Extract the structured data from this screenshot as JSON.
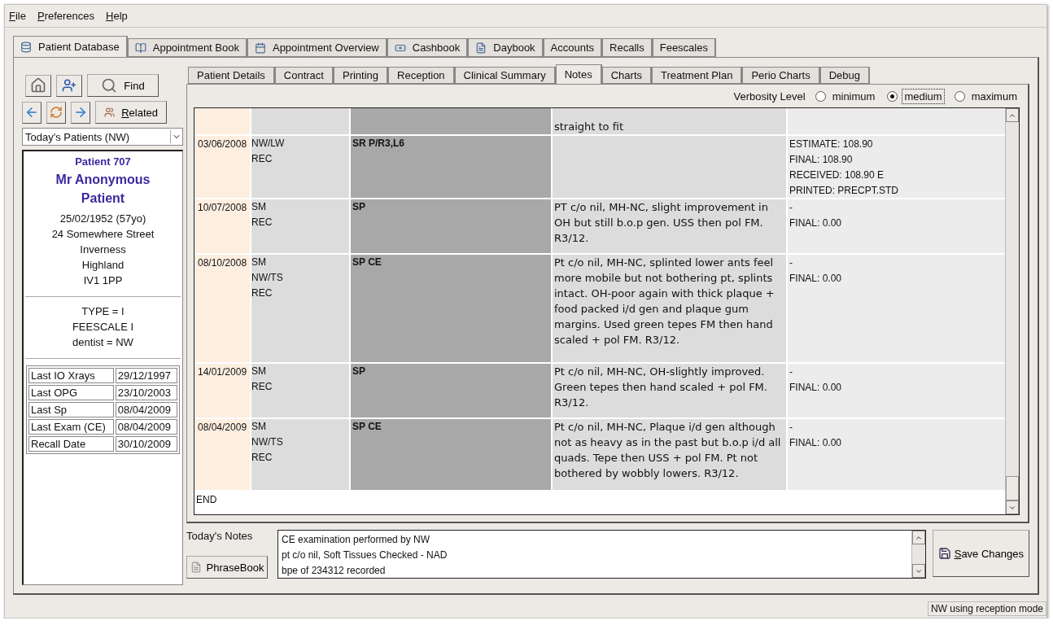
{
  "menu": [
    "File",
    "Preferences",
    "Help"
  ],
  "tabs": [
    {
      "label": "Patient Database",
      "selected": true
    },
    {
      "label": "Appointment Book",
      "selected": false
    },
    {
      "label": "Appointment Overview",
      "selected": false
    },
    {
      "label": "Cashbook",
      "selected": false
    },
    {
      "label": "Daybook",
      "selected": false
    },
    {
      "label": "Accounts",
      "selected": false
    },
    {
      "label": "Recalls",
      "selected": false
    },
    {
      "label": "Feescales",
      "selected": false
    }
  ],
  "sidebar": {
    "find_button": "Find",
    "related_button": "Related",
    "patient_list": "Today's Patients (NW)",
    "patient": {
      "heading": "Patient 707",
      "name": "Mr Anonymous Patient",
      "address": [
        "25/02/1952 (57yo)",
        "24 Somewhere Street",
        "Inverness",
        "Highland",
        "IV1 1PP"
      ],
      "details": [
        "TYPE = I",
        "FEESCALE I",
        "dentist = NW"
      ]
    },
    "history": [
      {
        "label": "Last IO Xrays",
        "date": "29/12/1997"
      },
      {
        "label": "Last OPG",
        "date": "23/10/2003"
      },
      {
        "label": "Last Sp",
        "date": "08/04/2009"
      },
      {
        "label": "Last Exam (CE)",
        "date": "08/04/2009"
      },
      {
        "label": "Recall Date",
        "date": "30/10/2009"
      }
    ]
  },
  "subtabs": [
    {
      "label": "Patient Details",
      "selected": false
    },
    {
      "label": "Contract",
      "selected": false
    },
    {
      "label": "Printing",
      "selected": false
    },
    {
      "label": "Reception",
      "selected": false
    },
    {
      "label": "Clinical Summary",
      "selected": false
    },
    {
      "label": "Notes",
      "selected": true
    },
    {
      "label": "Charts",
      "selected": false
    },
    {
      "label": "Treatment Plan",
      "selected": false
    },
    {
      "label": "Perio Charts",
      "selected": false
    },
    {
      "label": "Debug",
      "selected": false
    }
  ],
  "verbosity": {
    "label": "Verbosity Level",
    "options": [
      {
        "label": "minimum",
        "selected": false
      },
      {
        "label": "medium",
        "selected": true
      },
      {
        "label": "maximum",
        "selected": false
      }
    ]
  },
  "notes_table": {
    "rows": [
      {
        "date": "",
        "clinicians": [],
        "treatment": "",
        "notes": "straight to fit",
        "fees": []
      },
      {
        "date": "03/06/2008",
        "clinicians": [
          "NW/LW",
          "REC"
        ],
        "treatment": "SR P/R3,L6",
        "notes": "",
        "fees": [
          "ESTIMATE: 108.90",
          "FINAL: 108.90",
          "RECEIVED: 108.90 E",
          "PRINTED: PRECPT.STD"
        ]
      },
      {
        "date": "10/07/2008",
        "clinicians": [
          "SM",
          "REC"
        ],
        "treatment": "SP",
        "notes": "PT c/o nil, MH-NC, slight improvement in OH but still b.o.p gen. USS then pol FM. R3/12.",
        "fees": [
          "-",
          "FINAL: 0.00"
        ]
      },
      {
        "date": "08/10/2008",
        "clinicians": [
          "SM",
          "NW/TS",
          "REC"
        ],
        "treatment": "SP CE",
        "notes": "Pt c/o nil, MH-NC, splinted lower ants feel more mobile but not bothering pt, splints intact. OH-poor again with thick plaque + food packed i/d gen and plaque gum margins. Used green tepes FM then hand scaled + pol FM. R3/12.",
        "fees": [
          "-",
          "FINAL: 0.00"
        ]
      },
      {
        "date": "14/01/2009",
        "clinicians": [
          "SM",
          "REC"
        ],
        "treatment": "SP",
        "notes": "Pt c/o nil, MH-NC, OH-slightly improved. Green tepes then hand scaled + pol FM. R3/12.",
        "fees": [
          "-",
          "FINAL: 0.00"
        ]
      },
      {
        "date": "08/04/2009",
        "clinicians": [
          "SM",
          "NW/TS",
          "REC"
        ],
        "treatment": "SP CE",
        "notes": "Pt c/o nil, MH-NC, Plaque i/d gen although not as heavy as in the past but b.o.p i/d all quads. Tepe then USS + pol FM. Pt not bothered by wobbly lowers. R3/12.",
        "fees": [
          "-",
          "FINAL: 0.00"
        ]
      }
    ],
    "end": "END"
  },
  "todays_notes": {
    "label": "Today's Notes",
    "phrasebook_button": "PhraseBook",
    "lines": [
      "CE examination performed by NW",
      "pt c/o nil, Soft Tissues Checked - NAD",
      "bpe of 234312 recorded"
    ],
    "save_button": "Save Changes"
  },
  "status_bar": "NW using reception mode"
}
